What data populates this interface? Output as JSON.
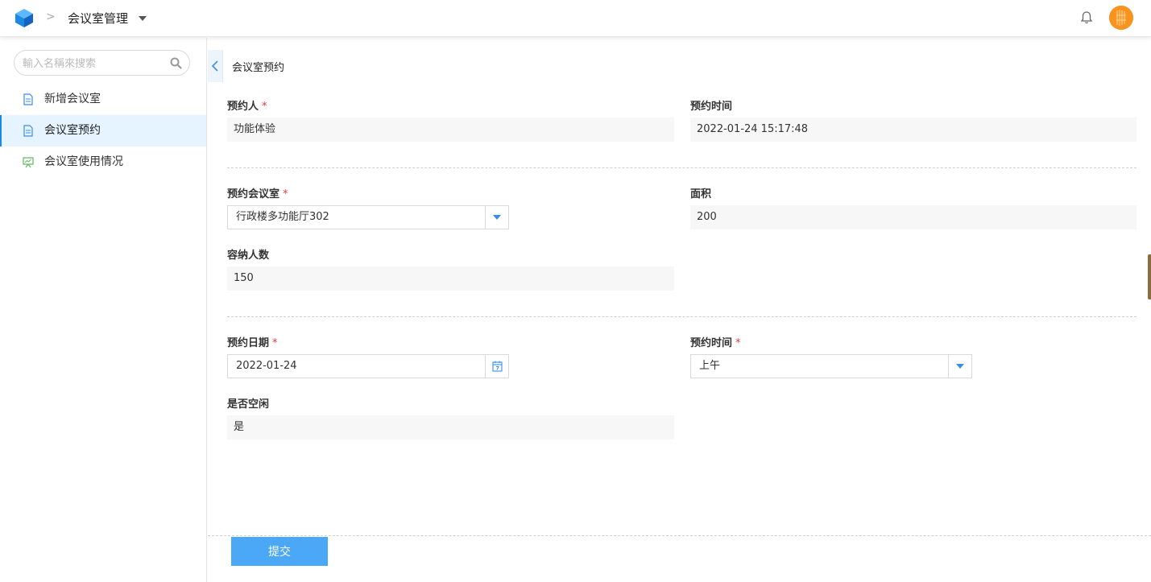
{
  "header": {
    "app_title": "会议室管理",
    "separator": ">",
    "logo_color": "#1e88e5",
    "avatar_color": "#f7931e"
  },
  "sidebar": {
    "search_placeholder": "輸入名稱來搜索",
    "items": [
      {
        "label": "新增会议室",
        "icon": "document-icon",
        "active": false
      },
      {
        "label": "会议室预约",
        "icon": "document-icon",
        "active": true
      },
      {
        "label": "会议室使用情况",
        "icon": "presentation-icon",
        "active": false
      }
    ]
  },
  "main": {
    "page_title": "会议室预约",
    "section1": {
      "booker_label": "预约人",
      "booker_value": "功能体验",
      "booked_time_label": "预约时间",
      "booked_time_value": "2022-01-24 15:17:48"
    },
    "section2": {
      "room_label": "预约会议室",
      "room_value": "行政楼多功能厅302",
      "area_label": "面积",
      "area_value": "200",
      "capacity_label": "容纳人数",
      "capacity_value": "150"
    },
    "section3": {
      "date_label": "预约日期",
      "date_value": "2022-01-24",
      "slot_label": "预约时间",
      "slot_value": "上午",
      "free_label": "是否空闲",
      "free_value": "是"
    },
    "required_mark": "*",
    "submit_label": "提交"
  },
  "colors": {
    "accent": "#1e88e5",
    "submit": "#4ba8f6",
    "required": "#e53935",
    "active_bg": "#e6f4ff"
  }
}
